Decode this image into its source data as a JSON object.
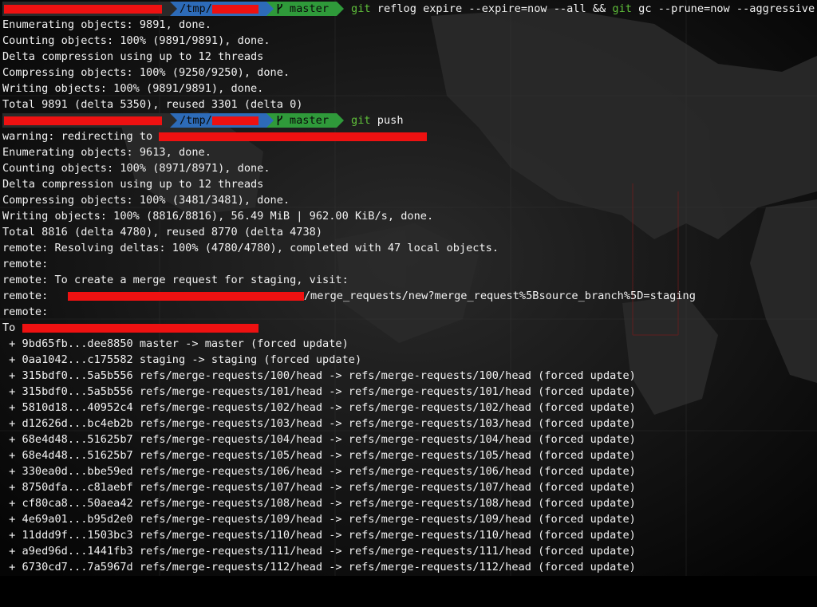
{
  "colors": {
    "background": "#000000",
    "text": "#f2f2f2",
    "path_segment": "#2d6bb8",
    "git_segment": "#2f9a3a",
    "command_keyword": "#5fbf3a",
    "redaction": "#ee1111"
  },
  "prompt": {
    "path": "/tmp/",
    "branch_icon": "git-branch-icon",
    "branch": "master"
  },
  "session": {
    "cmd1": {
      "git1": "git",
      "text1": " reflog expire --expire=now --all && ",
      "git2": "git",
      "text2": " gc --prune=now --aggressive"
    },
    "gc_output": [
      "Enumerating objects: 9891, done.",
      "Counting objects: 100% (9891/9891), done.",
      "Delta compression using up to 12 threads",
      "Compressing objects: 100% (9250/9250), done.",
      "Writing objects: 100% (9891/9891), done.",
      "Total 9891 (delta 5350), reused 3301 (delta 0)"
    ],
    "cmd2": {
      "git": "git",
      "text": " push"
    },
    "warning_prefix": "warning: redirecting to ",
    "push_output": [
      "Enumerating objects: 9613, done.",
      "Counting objects: 100% (8971/8971), done.",
      "Delta compression using up to 12 threads",
      "Compressing objects: 100% (3481/3481), done.",
      "Writing objects: 100% (8816/8816), 56.49 MiB | 962.00 KiB/s, done.",
      "Total 8816 (delta 4780), reused 8770 (delta 4738)",
      "remote: Resolving deltas: 100% (4780/4780), completed with 47 local objects.",
      "remote:",
      "remote: To create a merge request for staging, visit:"
    ],
    "remote_url_prefix": "remote:   ",
    "remote_url_suffix": "/merge_requests/new?merge_request%5Bsource_branch%5D=staging",
    "remote_blank": "remote:",
    "to_prefix": "To ",
    "updates": [
      " + 9bd65fb...dee8850 master -> master (forced update)",
      " + 0aa1042...c175582 staging -> staging (forced update)",
      " + 315bdf0...5a5b556 refs/merge-requests/100/head -> refs/merge-requests/100/head (forced update)",
      " + 315bdf0...5a5b556 refs/merge-requests/101/head -> refs/merge-requests/101/head (forced update)",
      " + 5810d18...40952c4 refs/merge-requests/102/head -> refs/merge-requests/102/head (forced update)",
      " + d12626d...bc4eb2b refs/merge-requests/103/head -> refs/merge-requests/103/head (forced update)",
      " + 68e4d48...51625b7 refs/merge-requests/104/head -> refs/merge-requests/104/head (forced update)",
      " + 68e4d48...51625b7 refs/merge-requests/105/head -> refs/merge-requests/105/head (forced update)",
      " + 330ea0d...bbe59ed refs/merge-requests/106/head -> refs/merge-requests/106/head (forced update)",
      " + 8750dfa...c81aebf refs/merge-requests/107/head -> refs/merge-requests/107/head (forced update)",
      " + cf80ca8...50aea42 refs/merge-requests/108/head -> refs/merge-requests/108/head (forced update)",
      " + 4e69a01...b95d2e0 refs/merge-requests/109/head -> refs/merge-requests/109/head (forced update)",
      " + 11ddd9f...1503bc3 refs/merge-requests/110/head -> refs/merge-requests/110/head (forced update)",
      " + a9ed96d...1441fb3 refs/merge-requests/111/head -> refs/merge-requests/111/head (forced update)",
      " + 6730cd7...7a5967d refs/merge-requests/112/head -> refs/merge-requests/112/head (forced update)"
    ]
  }
}
